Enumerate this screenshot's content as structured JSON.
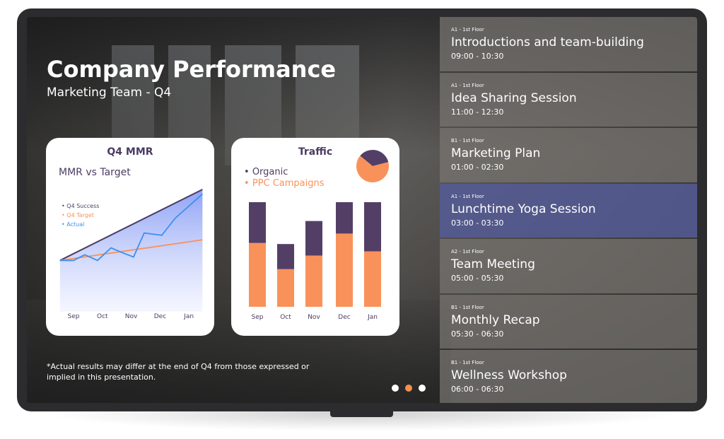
{
  "header": {
    "title": "Company Performance",
    "subtitle": "Marketing Team - Q4"
  },
  "mmr_card": {
    "title": "Q4 MMR",
    "subtitle": "MMR vs Target"
  },
  "traffic_card": {
    "title": "Traffic"
  },
  "disclaimer": "*Actual results may differ at the end of Q4 from those expressed or implied in this presentation.",
  "carousel": {
    "count": 3,
    "active_index": 1
  },
  "colors": {
    "purple": "#533f66",
    "orange": "#f9925a",
    "blue": "#3d8ff0",
    "active_item": "#555c96"
  },
  "chart_data": [
    {
      "type": "line",
      "title": "MMR vs Target",
      "categories": [
        "Sep",
        "Oct",
        "Nov",
        "Dec",
        "Jan"
      ],
      "ylim": [
        0,
        100
      ],
      "legend_placement": "top-left",
      "series": [
        {
          "name": "Q4 Success",
          "color": "#4b3c63",
          "points": [
            [
              -0.47,
              38
            ],
            [
              4.47,
              100
            ]
          ]
        },
        {
          "name": "Q4 Target",
          "color": "#f9925a",
          "points": [
            [
              -0.47,
              38
            ],
            [
              4.47,
              56
            ]
          ]
        },
        {
          "name": "Actual",
          "color": "#3d8ff0",
          "points": [
            [
              -0.47,
              38
            ],
            [
              0,
              38
            ],
            [
              0.39,
              43
            ],
            [
              0.83,
              38
            ],
            [
              1.3,
              49
            ],
            [
              1.67,
              45
            ],
            [
              2.08,
              41
            ],
            [
              2.45,
              62
            ],
            [
              3.06,
              60
            ],
            [
              3.53,
              75
            ],
            [
              4.47,
              96
            ]
          ]
        }
      ]
    },
    {
      "type": "bar",
      "stacked": true,
      "title": "Traffic",
      "categories": [
        "Sep",
        "Oct",
        "Nov",
        "Dec",
        "Jan"
      ],
      "ylim": [
        0,
        100
      ],
      "legend_placement": "top-left",
      "series": [
        {
          "name": "PPC Campaigns",
          "color": "#f9925a",
          "values": [
            61,
            36,
            49,
            70,
            53
          ]
        },
        {
          "name": "Organic",
          "color": "#533f66",
          "values": [
            39,
            24,
            33,
            30,
            47
          ]
        }
      ]
    },
    {
      "type": "pie",
      "slices": [
        {
          "name": "Organic",
          "value": 35,
          "color": "#533f66"
        },
        {
          "name": "PPC Campaigns",
          "value": 65,
          "color": "#f9925a"
        }
      ]
    }
  ],
  "schedule": [
    {
      "location": "A1 - 1st Floor",
      "name": "Introductions and team-building",
      "time": "09:00 - 10:30",
      "active": false
    },
    {
      "location": "A1 - 1st Floor",
      "name": "Idea Sharing Session",
      "time": "11:00 - 12:30",
      "active": false
    },
    {
      "location": "B1 - 1st Floor",
      "name": "Marketing Plan",
      "time": "01:00 - 02:30",
      "active": false
    },
    {
      "location": "A1 - 1st Floor",
      "name": "Lunchtime Yoga Session",
      "time": "03:00 - 03:30",
      "active": true
    },
    {
      "location": "A2 - 1st Floor",
      "name": "Team Meeting",
      "time": "05:00 - 05:30",
      "active": false
    },
    {
      "location": "B1 - 1st Floor",
      "name": "Monthly Recap",
      "time": "05:30 - 06:30",
      "active": false
    },
    {
      "location": "B1 - 1st Floor",
      "name": "Wellness Workshop",
      "time": "06:00 - 06:30",
      "active": false
    }
  ]
}
